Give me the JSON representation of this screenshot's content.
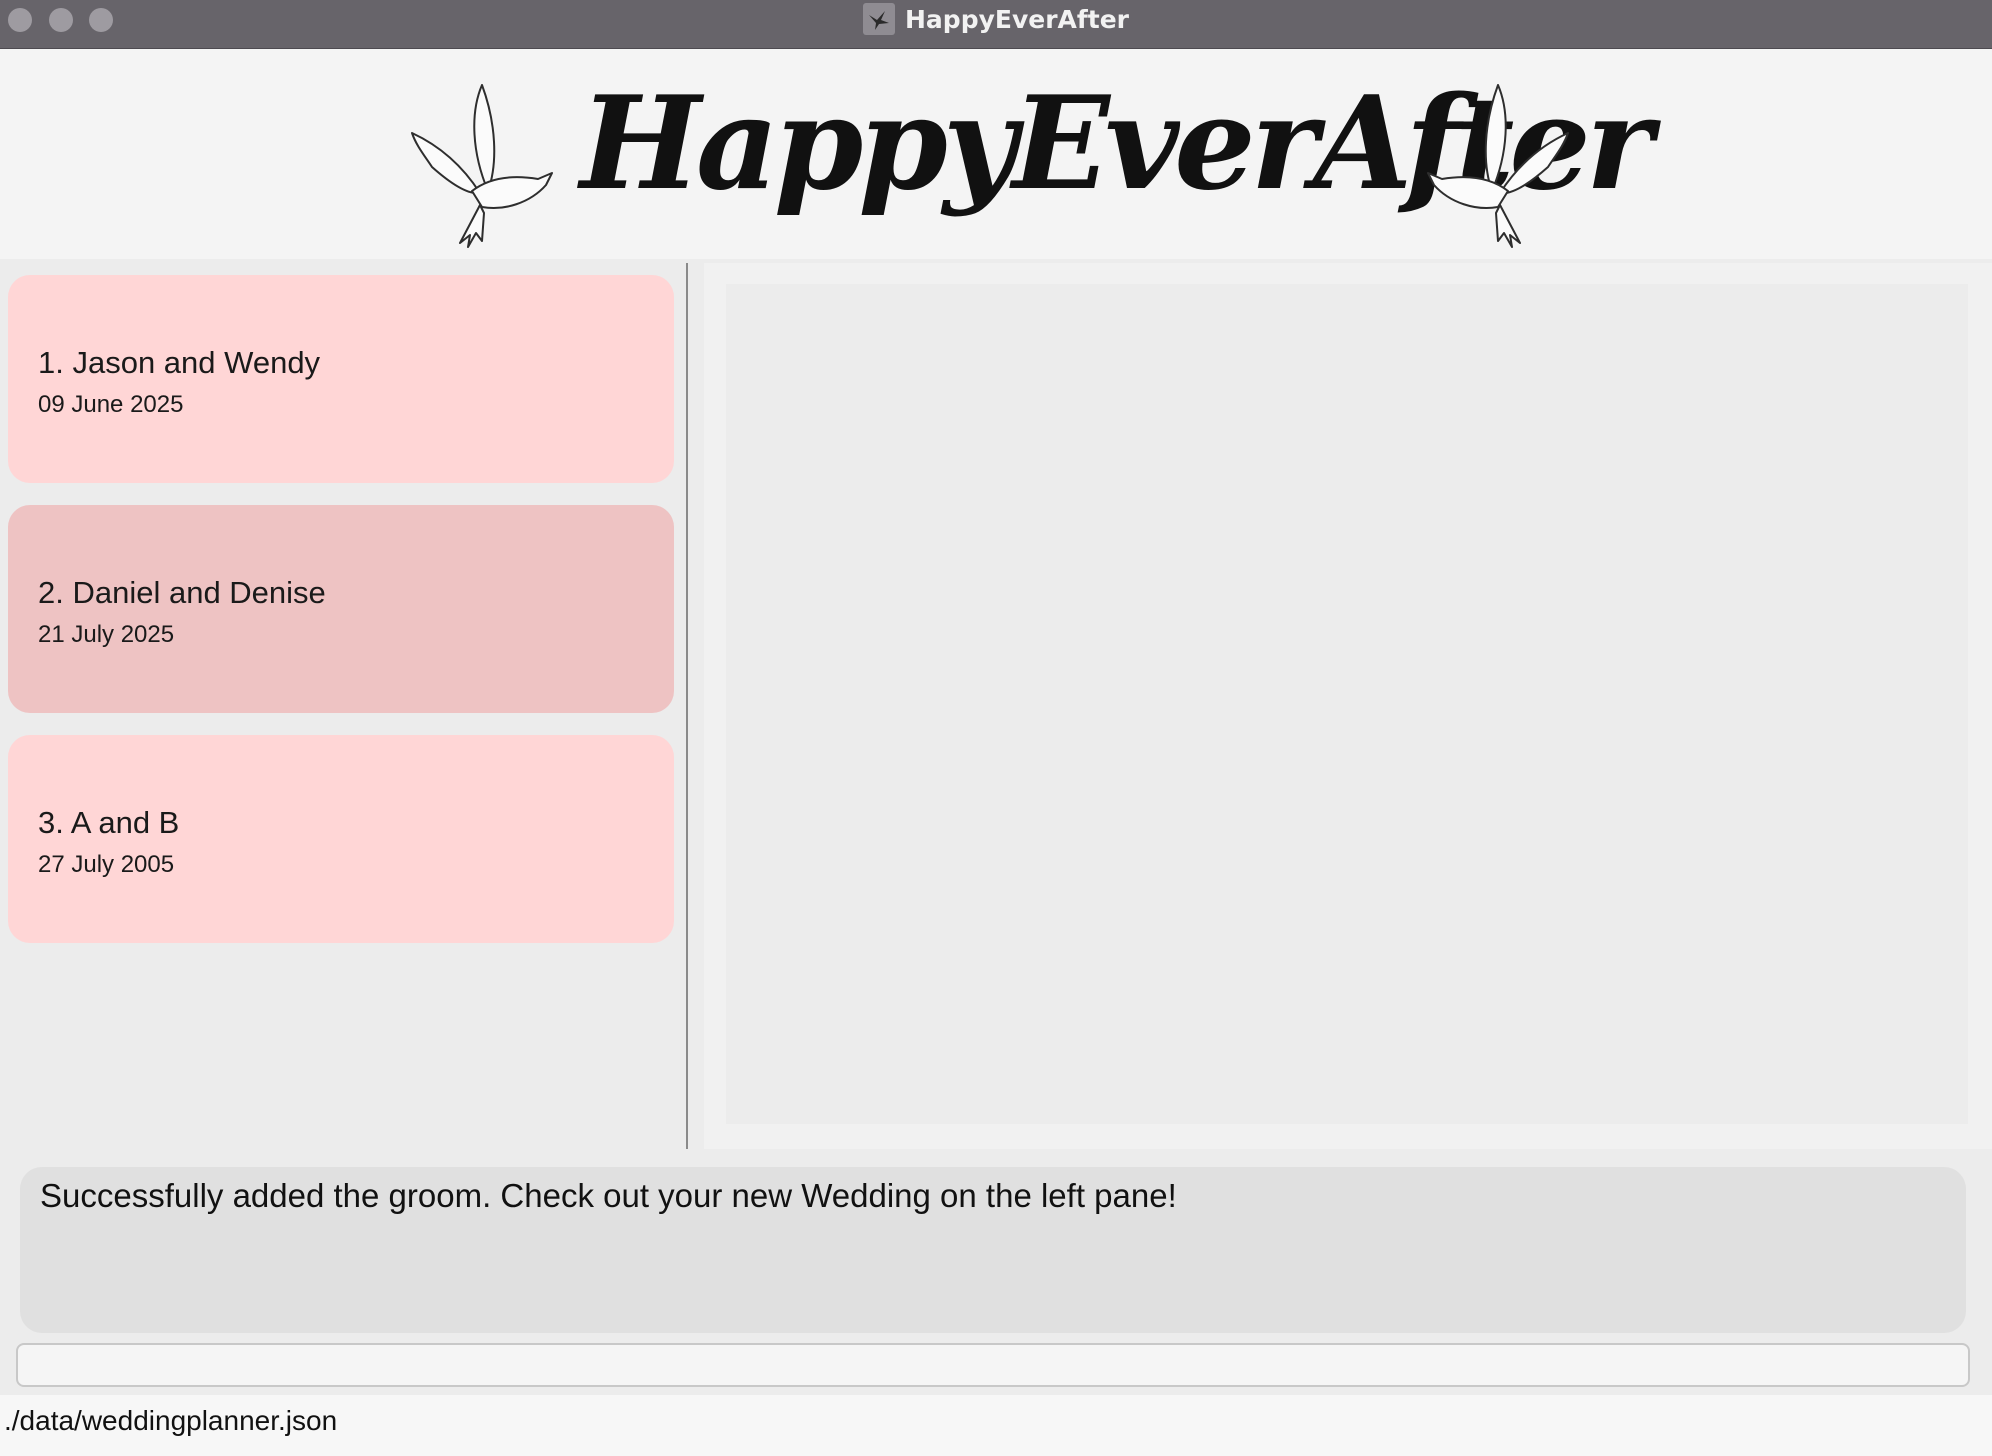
{
  "window": {
    "title": "HappyEverAfter",
    "app_icon": "dove-icon"
  },
  "header": {
    "logo_text": "HappyEverAfter",
    "decoration_icons": [
      "dove-icon",
      "dove-icon"
    ]
  },
  "weddings": [
    {
      "title": "1. Jason and Wendy",
      "date": "09 June 2025"
    },
    {
      "title": "2. Daniel and Denise",
      "date": "21 July 2025"
    },
    {
      "title": "3. A and B",
      "date": "27 July 2005"
    }
  ],
  "selected_index": 1,
  "result": {
    "message": "Successfully added the groom. Check out your new Wedding on the left pane!"
  },
  "command": {
    "value": "",
    "placeholder": ""
  },
  "status": {
    "file_path": "./data/weddingplanner.json"
  },
  "colors": {
    "titlebar": "#67646a",
    "card": "#ffd6d6",
    "card_selected": "#eec3c3",
    "result_box": "#e0e0e0"
  }
}
